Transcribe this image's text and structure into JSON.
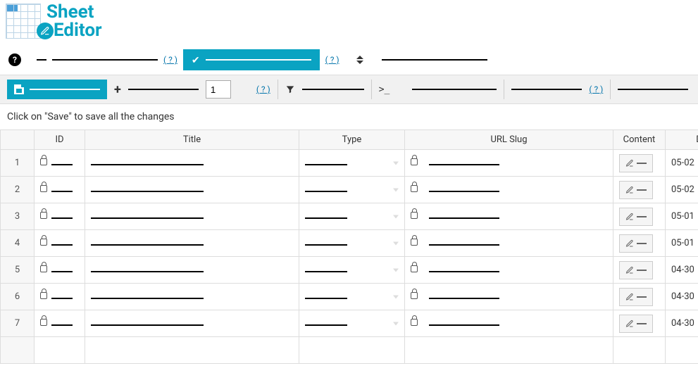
{
  "logo": {
    "line1": "Sheet",
    "line2": "Editor"
  },
  "toolbar1": {
    "help1": "( ? )",
    "help2": "( ? )"
  },
  "toolbar2": {
    "rows_input": "1",
    "help1": "( ? )",
    "help2": "( ? )"
  },
  "message": "Click on \"Save\" to save all the changes",
  "columns": {
    "rownum": "",
    "id": "ID",
    "title": "Title",
    "type": "Type",
    "slug": "URL Slug",
    "content": "Content",
    "date": "D"
  },
  "rows": [
    {
      "n": "1",
      "date": "05-02"
    },
    {
      "n": "2",
      "date": "05-02"
    },
    {
      "n": "3",
      "date": "05-01"
    },
    {
      "n": "4",
      "date": "05-01"
    },
    {
      "n": "5",
      "date": "04-30"
    },
    {
      "n": "6",
      "date": "04-30"
    },
    {
      "n": "7",
      "date": "04-30"
    }
  ]
}
